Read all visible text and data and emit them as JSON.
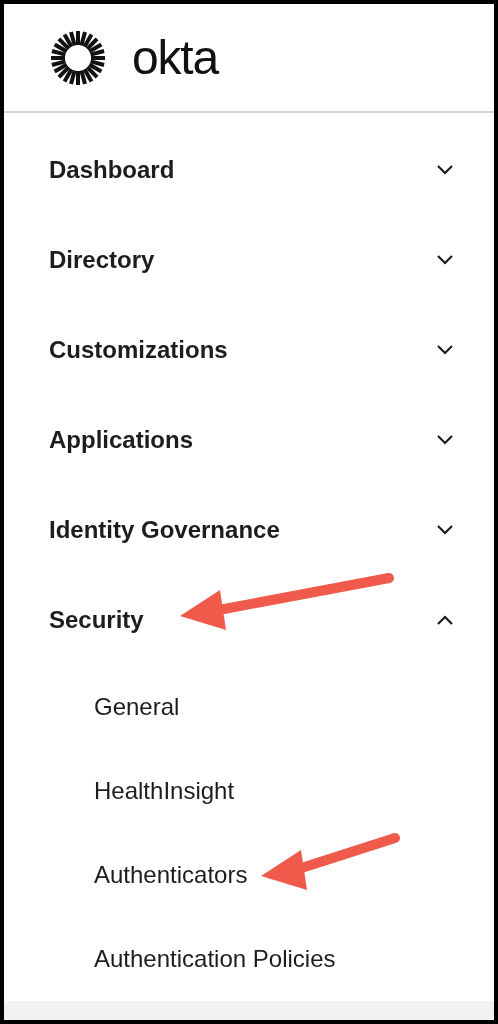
{
  "logo": {
    "text": "okta"
  },
  "nav": [
    {
      "label": "Dashboard",
      "expanded": false,
      "annotated": false
    },
    {
      "label": "Directory",
      "expanded": false,
      "annotated": false
    },
    {
      "label": "Customizations",
      "expanded": false,
      "annotated": false
    },
    {
      "label": "Applications",
      "expanded": false,
      "annotated": false
    },
    {
      "label": "Identity Governance",
      "expanded": false,
      "annotated": false
    },
    {
      "label": "Security",
      "expanded": true,
      "annotated": true,
      "children": [
        {
          "label": "General",
          "annotated": false
        },
        {
          "label": "HealthInsight",
          "annotated": false
        },
        {
          "label": "Authenticators",
          "annotated": true
        },
        {
          "label": "Authentication Policies",
          "annotated": false
        }
      ]
    }
  ]
}
